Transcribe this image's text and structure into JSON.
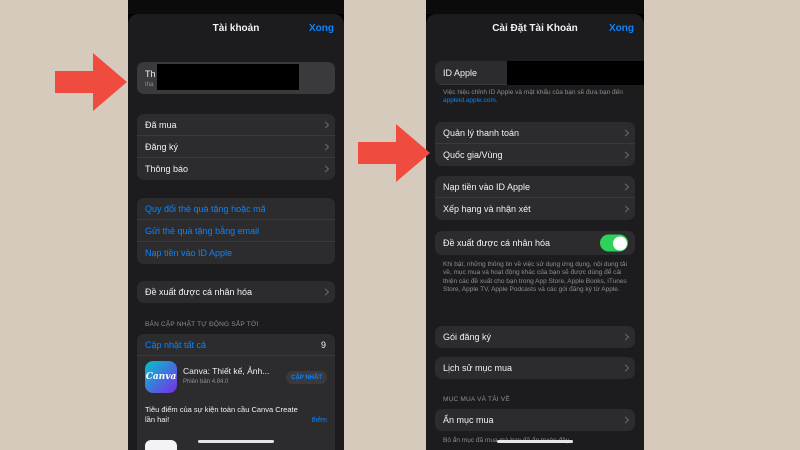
{
  "left": {
    "header": {
      "title": "Tài khoản",
      "done": "Xong"
    },
    "account": {
      "name_prefix": "Th",
      "sub_prefix": "tha"
    },
    "menu": [
      {
        "label": "Đã mua"
      },
      {
        "label": "Đăng ký"
      },
      {
        "label": "Thông báo"
      }
    ],
    "links": [
      {
        "label": "Quy đổi thẻ quà tặng hoặc mã"
      },
      {
        "label": "Gửi thẻ quà tặng bằng email"
      },
      {
        "label": "Nạp tiền vào ID Apple"
      }
    ],
    "personalized": "Đề xuất được cá nhân hóa",
    "updates": {
      "section_label": "BẢN CẬP NHẬT TỰ ĐỘNG SẮP TỚI",
      "update_all": "Cập nhật tất cả",
      "count": "9",
      "app": {
        "icon_text": "Canva",
        "name": "Canva: Thiết kế, Ảnh...",
        "version": "Phiên bản 4.84.0",
        "button": "CẬP NHẬT",
        "notes": "Tiêu điểm của sự kiện toàn cầu Canva Create lần hai!",
        "more": "thêm"
      }
    }
  },
  "right": {
    "header": {
      "title": "Cài Đặt Tài Khoản",
      "done": "Xong"
    },
    "apple_id": {
      "label": "ID Apple",
      "note_text": "Việc hiệu chỉnh ID Apple và mật khẩu của bạn sẽ đưa bạn đến",
      "note_link": "appleid.apple.com."
    },
    "group1": [
      {
        "label": "Quản lý thanh toán"
      },
      {
        "label": "Quốc gia/Vùng"
      }
    ],
    "group2": [
      {
        "label": "Nạp tiền vào ID Apple"
      },
      {
        "label": "Xếp hạng và nhận xét"
      }
    ],
    "personalized": {
      "label": "Đề xuất được cá nhân hóa",
      "enabled": true,
      "description": "Khi bật, những thông tin về việc sử dụng ứng dụng, nội dung tải về, mục mua và hoạt động khác của bạn sẽ được dùng để cải thiện các đề xuất cho bạn trong App Store, Apple Books, iTunes Store, Apple TV, Apple Podcasts và các gói đăng ký từ Apple."
    },
    "subscriptions": "Gói đăng ký",
    "purchase_history": "Lịch sử mục mua",
    "downloads": {
      "section_label": "MỤC MUA VÀ TẢI VỀ",
      "hide": "Ẩn mục mua",
      "caption": "Bỏ ẩn mục đã mua mà bạn đã ẩn trước đây."
    }
  },
  "colors": {
    "background": "#d6cabd",
    "arrow": "#ef4b3f",
    "accent": "#0a84ff",
    "toggle_on": "#30d158",
    "cell": "#2c2c2e",
    "sheet": "#1c1c1e"
  }
}
